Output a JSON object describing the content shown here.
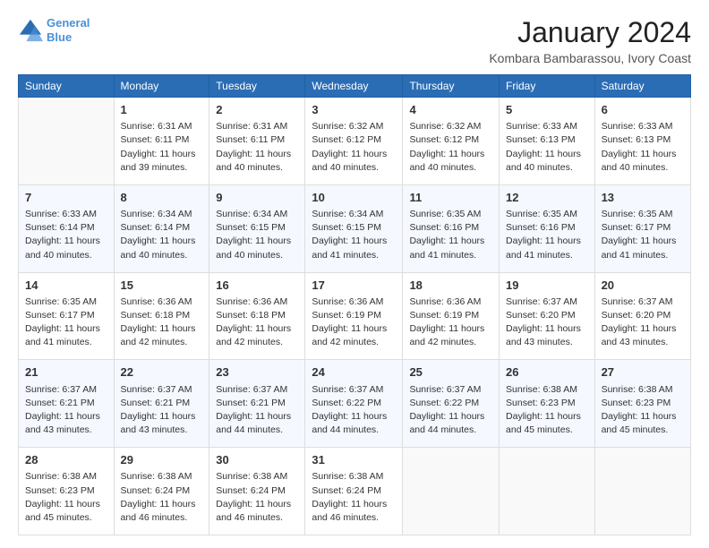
{
  "header": {
    "logo_line1": "General",
    "logo_line2": "Blue",
    "month_title": "January 2024",
    "location": "Kombara Bambarassou, Ivory Coast"
  },
  "weekdays": [
    "Sunday",
    "Monday",
    "Tuesday",
    "Wednesday",
    "Thursday",
    "Friday",
    "Saturday"
  ],
  "weeks": [
    [
      {
        "day": "",
        "info": ""
      },
      {
        "day": "1",
        "info": "Sunrise: 6:31 AM\nSunset: 6:11 PM\nDaylight: 11 hours\nand 39 minutes."
      },
      {
        "day": "2",
        "info": "Sunrise: 6:31 AM\nSunset: 6:11 PM\nDaylight: 11 hours\nand 40 minutes."
      },
      {
        "day": "3",
        "info": "Sunrise: 6:32 AM\nSunset: 6:12 PM\nDaylight: 11 hours\nand 40 minutes."
      },
      {
        "day": "4",
        "info": "Sunrise: 6:32 AM\nSunset: 6:12 PM\nDaylight: 11 hours\nand 40 minutes."
      },
      {
        "day": "5",
        "info": "Sunrise: 6:33 AM\nSunset: 6:13 PM\nDaylight: 11 hours\nand 40 minutes."
      },
      {
        "day": "6",
        "info": "Sunrise: 6:33 AM\nSunset: 6:13 PM\nDaylight: 11 hours\nand 40 minutes."
      }
    ],
    [
      {
        "day": "7",
        "info": "Sunrise: 6:33 AM\nSunset: 6:14 PM\nDaylight: 11 hours\nand 40 minutes."
      },
      {
        "day": "8",
        "info": "Sunrise: 6:34 AM\nSunset: 6:14 PM\nDaylight: 11 hours\nand 40 minutes."
      },
      {
        "day": "9",
        "info": "Sunrise: 6:34 AM\nSunset: 6:15 PM\nDaylight: 11 hours\nand 40 minutes."
      },
      {
        "day": "10",
        "info": "Sunrise: 6:34 AM\nSunset: 6:15 PM\nDaylight: 11 hours\nand 41 minutes."
      },
      {
        "day": "11",
        "info": "Sunrise: 6:35 AM\nSunset: 6:16 PM\nDaylight: 11 hours\nand 41 minutes."
      },
      {
        "day": "12",
        "info": "Sunrise: 6:35 AM\nSunset: 6:16 PM\nDaylight: 11 hours\nand 41 minutes."
      },
      {
        "day": "13",
        "info": "Sunrise: 6:35 AM\nSunset: 6:17 PM\nDaylight: 11 hours\nand 41 minutes."
      }
    ],
    [
      {
        "day": "14",
        "info": "Sunrise: 6:35 AM\nSunset: 6:17 PM\nDaylight: 11 hours\nand 41 minutes."
      },
      {
        "day": "15",
        "info": "Sunrise: 6:36 AM\nSunset: 6:18 PM\nDaylight: 11 hours\nand 42 minutes."
      },
      {
        "day": "16",
        "info": "Sunrise: 6:36 AM\nSunset: 6:18 PM\nDaylight: 11 hours\nand 42 minutes."
      },
      {
        "day": "17",
        "info": "Sunrise: 6:36 AM\nSunset: 6:19 PM\nDaylight: 11 hours\nand 42 minutes."
      },
      {
        "day": "18",
        "info": "Sunrise: 6:36 AM\nSunset: 6:19 PM\nDaylight: 11 hours\nand 42 minutes."
      },
      {
        "day": "19",
        "info": "Sunrise: 6:37 AM\nSunset: 6:20 PM\nDaylight: 11 hours\nand 43 minutes."
      },
      {
        "day": "20",
        "info": "Sunrise: 6:37 AM\nSunset: 6:20 PM\nDaylight: 11 hours\nand 43 minutes."
      }
    ],
    [
      {
        "day": "21",
        "info": "Sunrise: 6:37 AM\nSunset: 6:21 PM\nDaylight: 11 hours\nand 43 minutes."
      },
      {
        "day": "22",
        "info": "Sunrise: 6:37 AM\nSunset: 6:21 PM\nDaylight: 11 hours\nand 43 minutes."
      },
      {
        "day": "23",
        "info": "Sunrise: 6:37 AM\nSunset: 6:21 PM\nDaylight: 11 hours\nand 44 minutes."
      },
      {
        "day": "24",
        "info": "Sunrise: 6:37 AM\nSunset: 6:22 PM\nDaylight: 11 hours\nand 44 minutes."
      },
      {
        "day": "25",
        "info": "Sunrise: 6:37 AM\nSunset: 6:22 PM\nDaylight: 11 hours\nand 44 minutes."
      },
      {
        "day": "26",
        "info": "Sunrise: 6:38 AM\nSunset: 6:23 PM\nDaylight: 11 hours\nand 45 minutes."
      },
      {
        "day": "27",
        "info": "Sunrise: 6:38 AM\nSunset: 6:23 PM\nDaylight: 11 hours\nand 45 minutes."
      }
    ],
    [
      {
        "day": "28",
        "info": "Sunrise: 6:38 AM\nSunset: 6:23 PM\nDaylight: 11 hours\nand 45 minutes."
      },
      {
        "day": "29",
        "info": "Sunrise: 6:38 AM\nSunset: 6:24 PM\nDaylight: 11 hours\nand 46 minutes."
      },
      {
        "day": "30",
        "info": "Sunrise: 6:38 AM\nSunset: 6:24 PM\nDaylight: 11 hours\nand 46 minutes."
      },
      {
        "day": "31",
        "info": "Sunrise: 6:38 AM\nSunset: 6:24 PM\nDaylight: 11 hours\nand 46 minutes."
      },
      {
        "day": "",
        "info": ""
      },
      {
        "day": "",
        "info": ""
      },
      {
        "day": "",
        "info": ""
      }
    ]
  ]
}
